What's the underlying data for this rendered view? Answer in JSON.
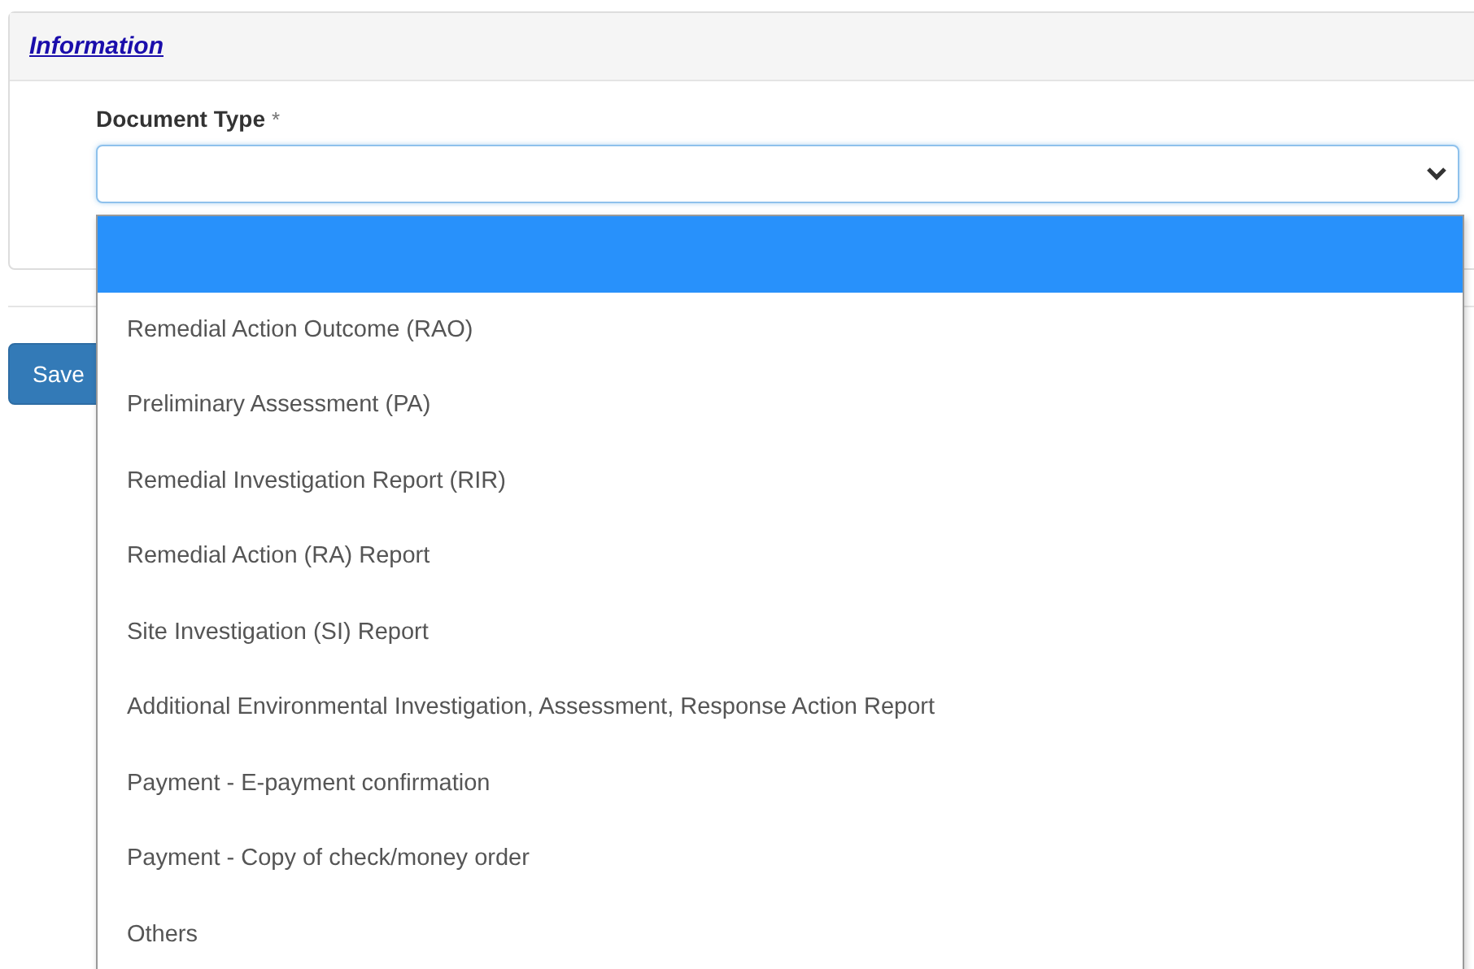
{
  "panel": {
    "title": "Information"
  },
  "field": {
    "label": "Document Type",
    "required_mark": "*"
  },
  "save_button": {
    "label": "Save"
  },
  "dropdown": {
    "options": [
      {
        "selected": true
      },
      {
        "label": "Remedial Action Outcome (RAO)",
        "selected": false
      },
      {
        "label": "Preliminary Assessment (PA)",
        "selected": false
      },
      {
        "label": "Remedial Investigation Report (RIR)",
        "selected": false
      },
      {
        "label": "Remedial Action (RA) Report",
        "selected": false
      },
      {
        "label": "Site Investigation (SI) Report",
        "selected": false
      },
      {
        "label": "Additional Environmental Investigation, Assessment, Response Action Report",
        "selected": false
      },
      {
        "label": "Payment - E-payment confirmation",
        "selected": false
      },
      {
        "label": "Payment - Copy of check/money order",
        "selected": false
      },
      {
        "label": "Others",
        "selected": false
      }
    ]
  }
}
